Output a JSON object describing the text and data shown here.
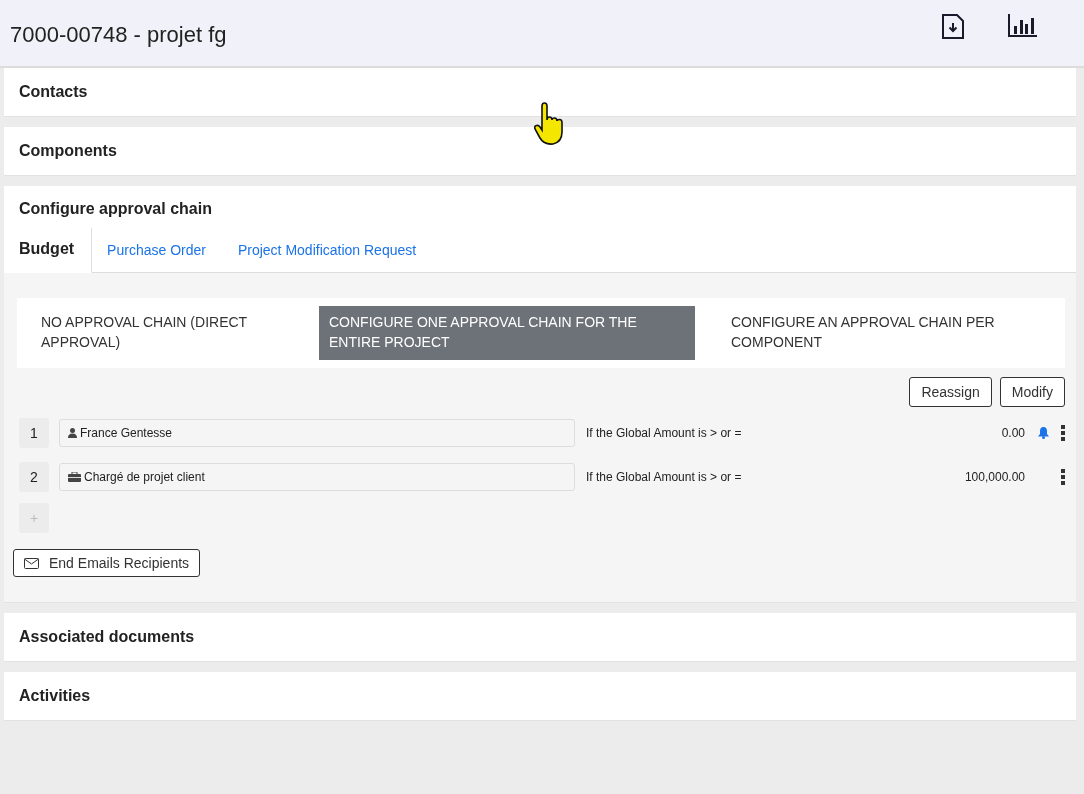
{
  "header": {
    "title": "7000-00748 - projet fg"
  },
  "sections_top": [
    {
      "title": "Contacts"
    },
    {
      "title": "Components"
    }
  ],
  "approval": {
    "title": "Configure approval chain",
    "tabs": [
      {
        "label": "Budget",
        "selected": true
      },
      {
        "label": "Purchase Order",
        "selected": false
      },
      {
        "label": "Project Modification Request",
        "selected": false
      }
    ],
    "options": [
      {
        "label": "NO APPROVAL CHAIN (DIRECT APPROVAL)",
        "selected": false
      },
      {
        "label": "CONFIGURE ONE APPROVAL CHAIN FOR THE ENTIRE PROJECT",
        "selected": true
      },
      {
        "label": "CONFIGURE AN APPROVAL CHAIN PER COMPONENT",
        "selected": false
      }
    ],
    "actions": [
      "Reassign",
      "Modify"
    ],
    "steps": [
      {
        "number": "1",
        "kind": "person",
        "approver": "France Gentesse",
        "condition": "If the Global Amount is > or =",
        "amount": "0.00",
        "notify": true
      },
      {
        "number": "2",
        "kind": "role",
        "approver": "Chargé de projet client",
        "condition": "If the Global Amount is > or =",
        "amount": "100,000.00",
        "notify": false
      }
    ],
    "add_step": "+",
    "email_button": "End Emails Recipients"
  },
  "sections_bottom": [
    {
      "title": "Associated documents"
    },
    {
      "title": "Activities"
    }
  ]
}
